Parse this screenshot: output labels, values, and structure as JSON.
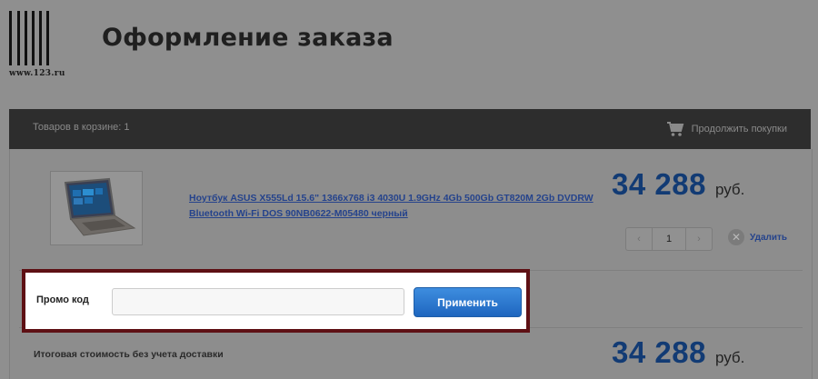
{
  "header": {
    "logo_url": "www.123.ru",
    "title": "Оформление заказа"
  },
  "cart_bar": {
    "items_in_cart": "Товаров в корзине: 1",
    "continue_shopping": "Продолжить покупки"
  },
  "cart_items": [
    {
      "name": "Ноутбук ASUS X555Ld 15.6\" 1366x768 i3 4030U 1.9GHz 4Gb 500Gb GT820M 2Gb DVDRW Bluetooth Wi-Fi DOS 90NB0622-M05480 черный",
      "price": "34 288",
      "currency": "руб.",
      "quantity": "1",
      "qty_minus": "‹",
      "qty_plus": "›",
      "remove_label": "Удалить",
      "remove_icon": "✕"
    }
  ],
  "promo": {
    "label": "Промо код",
    "input_value": "",
    "input_placeholder": "",
    "apply_label": "Применить"
  },
  "total": {
    "label": "Итоговая стоимость без учета доставки",
    "price": "34 288",
    "currency": "руб."
  },
  "colors": {
    "overlay": "#8f8f8f",
    "cart_bar": "#2d2d2d",
    "price": "#123b74",
    "highlight_border": "#5e1014",
    "apply_button": "#1e66bf"
  }
}
